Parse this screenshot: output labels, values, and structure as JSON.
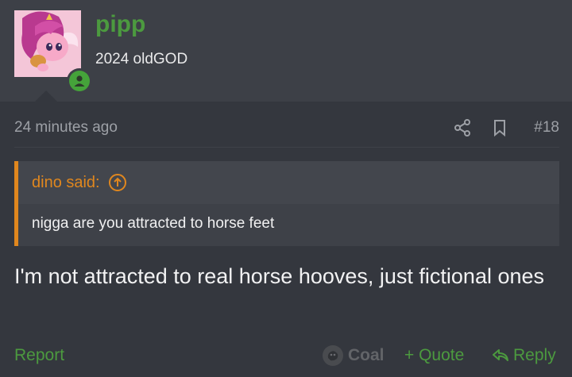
{
  "user": {
    "username": "pipp",
    "title": "2024 oldGOD",
    "avatar_icon": "pony-avatar",
    "status_icon": "online-user-icon"
  },
  "post": {
    "timestamp": "24 minutes ago",
    "number": "#18",
    "quote": {
      "author_label": "dino said:",
      "text": "nigga are you attracted to horse feet"
    },
    "body": "I'm not attracted to real horse hooves, just fictional ones"
  },
  "actions": {
    "report": "Report",
    "reaction": "Coal",
    "quote": "+ Quote",
    "reply": "Reply"
  },
  "colors": {
    "accent_green": "#4c9a3f",
    "quote_orange": "#e0871e",
    "background": "#34373e"
  }
}
